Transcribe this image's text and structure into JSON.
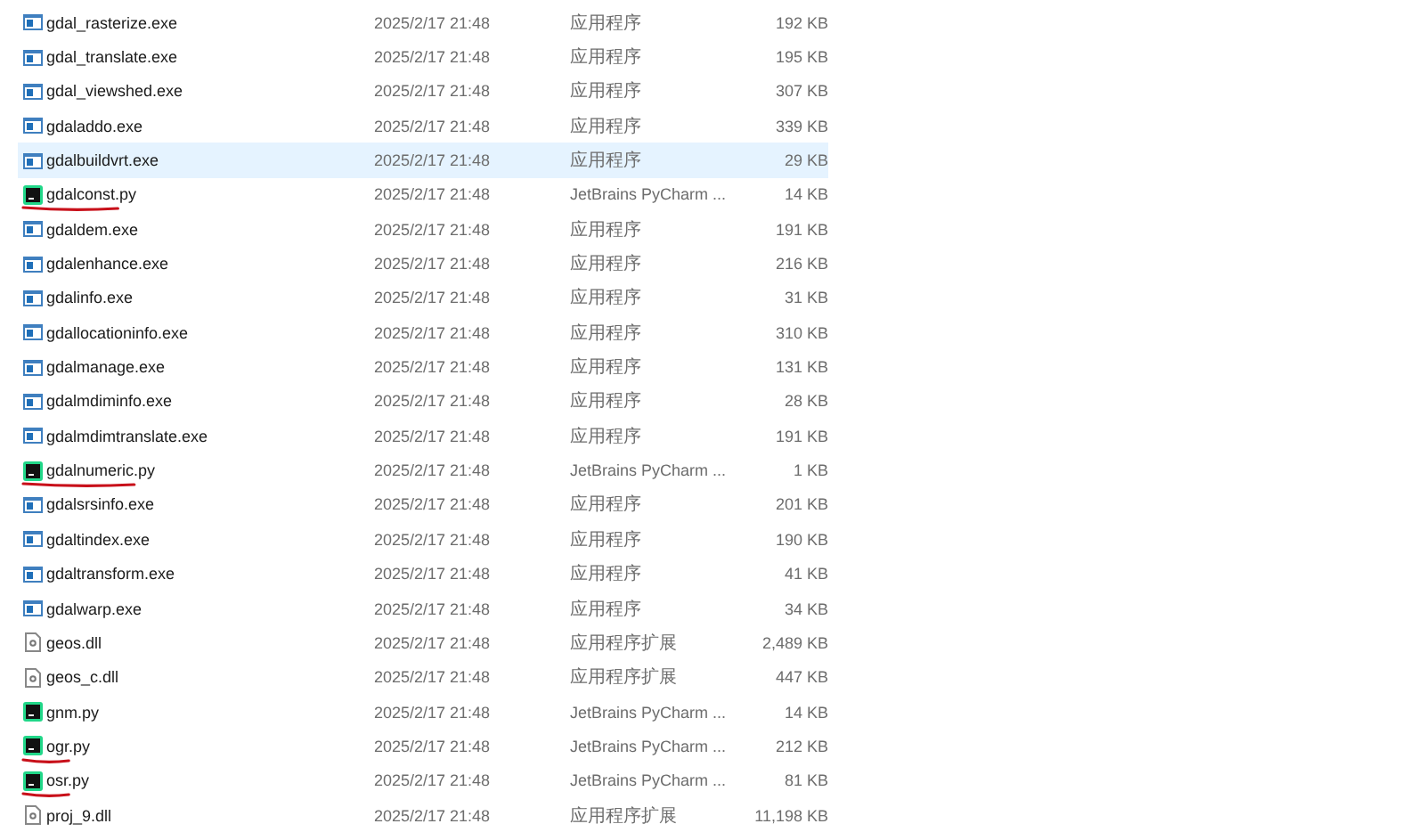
{
  "files": [
    {
      "name": "gdal_rasterize.exe",
      "kind": "exe",
      "date": "2025/2/17 21:48",
      "type": "应用程序",
      "size": "192 KB",
      "selected": false,
      "underlined": false
    },
    {
      "name": "gdal_translate.exe",
      "kind": "exe",
      "date": "2025/2/17 21:48",
      "type": "应用程序",
      "size": "195 KB",
      "selected": false,
      "underlined": false
    },
    {
      "name": "gdal_viewshed.exe",
      "kind": "exe",
      "date": "2025/2/17 21:48",
      "type": "应用程序",
      "size": "307 KB",
      "selected": false,
      "underlined": false
    },
    {
      "name": "gdaladdo.exe",
      "kind": "exe",
      "date": "2025/2/17 21:48",
      "type": "应用程序",
      "size": "339 KB",
      "selected": false,
      "underlined": false
    },
    {
      "name": "gdalbuildvrt.exe",
      "kind": "exe",
      "date": "2025/2/17 21:48",
      "type": "应用程序",
      "size": "29 KB",
      "selected": true,
      "underlined": false
    },
    {
      "name": "gdalconst.py",
      "kind": "py",
      "date": "2025/2/17 21:48",
      "type": "JetBrains PyCharm ...",
      "size": "14 KB",
      "selected": false,
      "underlined": true
    },
    {
      "name": "gdaldem.exe",
      "kind": "exe",
      "date": "2025/2/17 21:48",
      "type": "应用程序",
      "size": "191 KB",
      "selected": false,
      "underlined": false
    },
    {
      "name": "gdalenhance.exe",
      "kind": "exe",
      "date": "2025/2/17 21:48",
      "type": "应用程序",
      "size": "216 KB",
      "selected": false,
      "underlined": false
    },
    {
      "name": "gdalinfo.exe",
      "kind": "exe",
      "date": "2025/2/17 21:48",
      "type": "应用程序",
      "size": "31 KB",
      "selected": false,
      "underlined": false
    },
    {
      "name": "gdallocationinfo.exe",
      "kind": "exe",
      "date": "2025/2/17 21:48",
      "type": "应用程序",
      "size": "310 KB",
      "selected": false,
      "underlined": false
    },
    {
      "name": "gdalmanage.exe",
      "kind": "exe",
      "date": "2025/2/17 21:48",
      "type": "应用程序",
      "size": "131 KB",
      "selected": false,
      "underlined": false
    },
    {
      "name": "gdalmdiminfo.exe",
      "kind": "exe",
      "date": "2025/2/17 21:48",
      "type": "应用程序",
      "size": "28 KB",
      "selected": false,
      "underlined": false
    },
    {
      "name": "gdalmdimtranslate.exe",
      "kind": "exe",
      "date": "2025/2/17 21:48",
      "type": "应用程序",
      "size": "191 KB",
      "selected": false,
      "underlined": false
    },
    {
      "name": "gdalnumeric.py",
      "kind": "py",
      "date": "2025/2/17 21:48",
      "type": "JetBrains PyCharm ...",
      "size": "1 KB",
      "selected": false,
      "underlined": true
    },
    {
      "name": "gdalsrsinfo.exe",
      "kind": "exe",
      "date": "2025/2/17 21:48",
      "type": "应用程序",
      "size": "201 KB",
      "selected": false,
      "underlined": false
    },
    {
      "name": "gdaltindex.exe",
      "kind": "exe",
      "date": "2025/2/17 21:48",
      "type": "应用程序",
      "size": "190 KB",
      "selected": false,
      "underlined": false
    },
    {
      "name": "gdaltransform.exe",
      "kind": "exe",
      "date": "2025/2/17 21:48",
      "type": "应用程序",
      "size": "41 KB",
      "selected": false,
      "underlined": false
    },
    {
      "name": "gdalwarp.exe",
      "kind": "exe",
      "date": "2025/2/17 21:48",
      "type": "应用程序",
      "size": "34 KB",
      "selected": false,
      "underlined": false
    },
    {
      "name": "geos.dll",
      "kind": "dll",
      "date": "2025/2/17 21:48",
      "type": "应用程序扩展",
      "size": "2,489 KB",
      "selected": false,
      "underlined": false
    },
    {
      "name": "geos_c.dll",
      "kind": "dll",
      "date": "2025/2/17 21:48",
      "type": "应用程序扩展",
      "size": "447 KB",
      "selected": false,
      "underlined": false
    },
    {
      "name": "gnm.py",
      "kind": "py",
      "date": "2025/2/17 21:48",
      "type": "JetBrains PyCharm ...",
      "size": "14 KB",
      "selected": false,
      "underlined": false
    },
    {
      "name": "ogr.py",
      "kind": "py",
      "date": "2025/2/17 21:48",
      "type": "JetBrains PyCharm ...",
      "size": "212 KB",
      "selected": false,
      "underlined": true
    },
    {
      "name": "osr.py",
      "kind": "py",
      "date": "2025/2/17 21:48",
      "type": "JetBrains PyCharm ...",
      "size": "81 KB",
      "selected": false,
      "underlined": true
    },
    {
      "name": "proj_9.dll",
      "kind": "dll",
      "date": "2025/2/17 21:48",
      "type": "应用程序扩展",
      "size": "11,198 KB",
      "selected": false,
      "underlined": false
    }
  ]
}
